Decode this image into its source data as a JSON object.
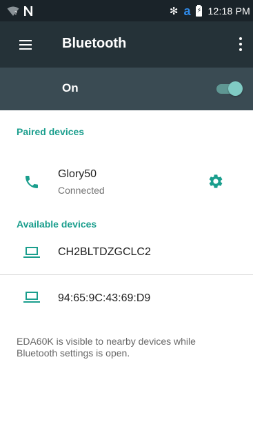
{
  "status_bar": {
    "icons": [
      "wifi-question-icon",
      "n-icon",
      "bluetooth-icon",
      "a-app-icon",
      "battery-charging-icon"
    ],
    "time": "12:18 PM"
  },
  "toolbar": {
    "title": "Bluetooth",
    "menu_icon": "hamburger-menu-icon",
    "overflow_icon": "more-vert-icon"
  },
  "master_switch": {
    "label": "On",
    "state": "on",
    "accent": "#80cbc4"
  },
  "paired": {
    "header": "Paired devices",
    "devices": [
      {
        "name": "Glory50",
        "status": "Connected",
        "icon": "phone-icon",
        "action_icon": "gear-icon"
      }
    ]
  },
  "available": {
    "header": "Available devices",
    "devices": [
      {
        "name": "CH2BLTDZGCLC2",
        "icon": "laptop-icon"
      },
      {
        "name": "94:65:9C:43:69:D9",
        "icon": "laptop-icon"
      }
    ]
  },
  "footer": {
    "text": "EDA60K is visible to nearby devices while Bluetooth settings is open."
  },
  "colors": {
    "status_bar": "#1a2329",
    "toolbar": "#253238",
    "switch_bar": "#3a4b53",
    "accent": "#1a9e8d"
  }
}
